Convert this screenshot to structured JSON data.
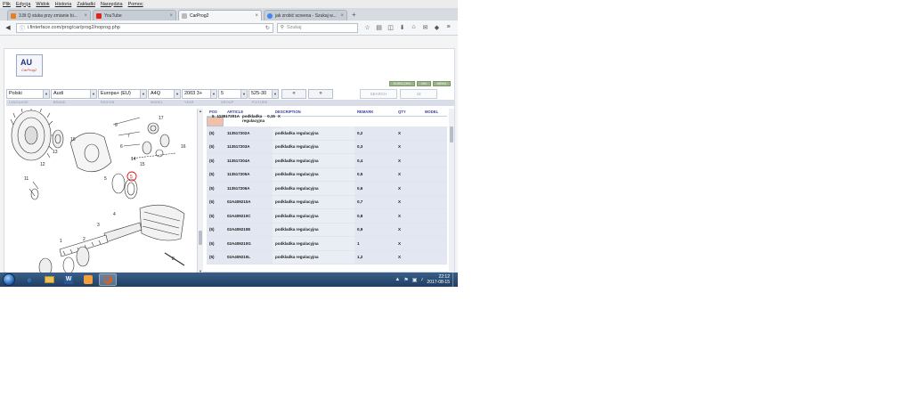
{
  "menu": [
    "Plik",
    "Edycja",
    "Widok",
    "Historia",
    "Zakładki",
    "Narzędzia",
    "Pomoc"
  ],
  "tabs": [
    {
      "label": "3.8t Q stuka przy zmianie bi...",
      "icon_color": "#e67e22",
      "active": false
    },
    {
      "label": "YouTube",
      "icon_color": "#e62117",
      "active": false
    },
    {
      "label": "CarProg2",
      "icon_color": "#888888",
      "active": true
    },
    {
      "label": "jak zrobić screena - Szukaj w...",
      "icon_color": "#4285f4",
      "active": false
    }
  ],
  "nav": {
    "url": "i.finterface.com/prog/car/prog2/noprog.php",
    "search_placeholder": "Szukaj"
  },
  "logo": {
    "title": "AU",
    "subtitle": "CarProg2"
  },
  "mini_strip": [
    "EURO-CHN",
    "VIN",
    "MENU"
  ],
  "selectors": [
    {
      "value": "Polski",
      "label": "LANGUAGE"
    },
    {
      "value": "Audi",
      "label": "BRAND"
    },
    {
      "value": "Europa+ (EU)",
      "label": "REGION"
    },
    {
      "value": "A4Q",
      "label": "MODEL"
    },
    {
      "value": "2003  3+",
      "label": "YEAR"
    },
    {
      "value": "5",
      "label": "GROUP"
    },
    {
      "value": "525-30",
      "label": "PICTURE"
    }
  ],
  "pager": {
    "prev": "«",
    "next": "»"
  },
  "search_field": {
    "label": "SEARCH",
    "count": "43"
  },
  "table": {
    "headers": [
      "POS",
      "ARTICLE",
      "DESCRIPTION",
      "REMARK",
      "QTY",
      "MODEL"
    ],
    "rows": [
      {
        "pos": "5",
        "article": "113517201A",
        "desc": "podkladka regulacyjna",
        "remark": "0,15",
        "qty": "X",
        "model": "",
        "selected": true
      },
      {
        "pos": "(5)",
        "article": "113517202A",
        "desc": "podkladka regulacyjna",
        "remark": "0,2",
        "qty": "X",
        "model": ""
      },
      {
        "pos": "(5)",
        "article": "113517203A",
        "desc": "podkladka regulacyjna",
        "remark": "0,3",
        "qty": "X",
        "model": ""
      },
      {
        "pos": "(5)",
        "article": "113517204A",
        "desc": "podkladka regulacyjna",
        "remark": "0,4",
        "qty": "X",
        "model": ""
      },
      {
        "pos": "(5)",
        "article": "113517205A",
        "desc": "podkladka regulacyjna",
        "remark": "0,5",
        "qty": "X",
        "model": ""
      },
      {
        "pos": "(5)",
        "article": "113517206A",
        "desc": "podkladka regulacyjna",
        "remark": "0,6",
        "qty": "X",
        "model": ""
      },
      {
        "pos": "(5)",
        "article": "02A409210A",
        "desc": "podkladka regulacyjna",
        "remark": "0,7",
        "qty": "X",
        "model": ""
      },
      {
        "pos": "(5)",
        "article": "02A409210C",
        "desc": "podkladka regulacyjna",
        "remark": "0,8",
        "qty": "X",
        "model": ""
      },
      {
        "pos": "(5)",
        "article": "02A409210E",
        "desc": "podkladka regulacyjna",
        "remark": "0,9",
        "qty": "X",
        "model": ""
      },
      {
        "pos": "(5)",
        "article": "02A409210G",
        "desc": "podkladka regulacyjna",
        "remark": "1",
        "qty": "X",
        "model": ""
      },
      {
        "pos": "(5)",
        "article": "02A409210L",
        "desc": "podkladka regulacyjna",
        "remark": "1,2",
        "qty": "X",
        "model": ""
      }
    ]
  },
  "diagram": {
    "callouts": [
      "9",
      "7",
      "6",
      "14",
      "15",
      "17",
      "5",
      "16",
      "10",
      "13",
      "12",
      "11",
      "4",
      "3",
      "2",
      "1",
      "8"
    ],
    "highlight": "5"
  },
  "clock": {
    "time": "22:12",
    "date": "2017-08-15"
  },
  "colors": {
    "selected_row": "#f0c1a8",
    "row": "#e2e7f1",
    "header_text": "#3b3f9c"
  }
}
